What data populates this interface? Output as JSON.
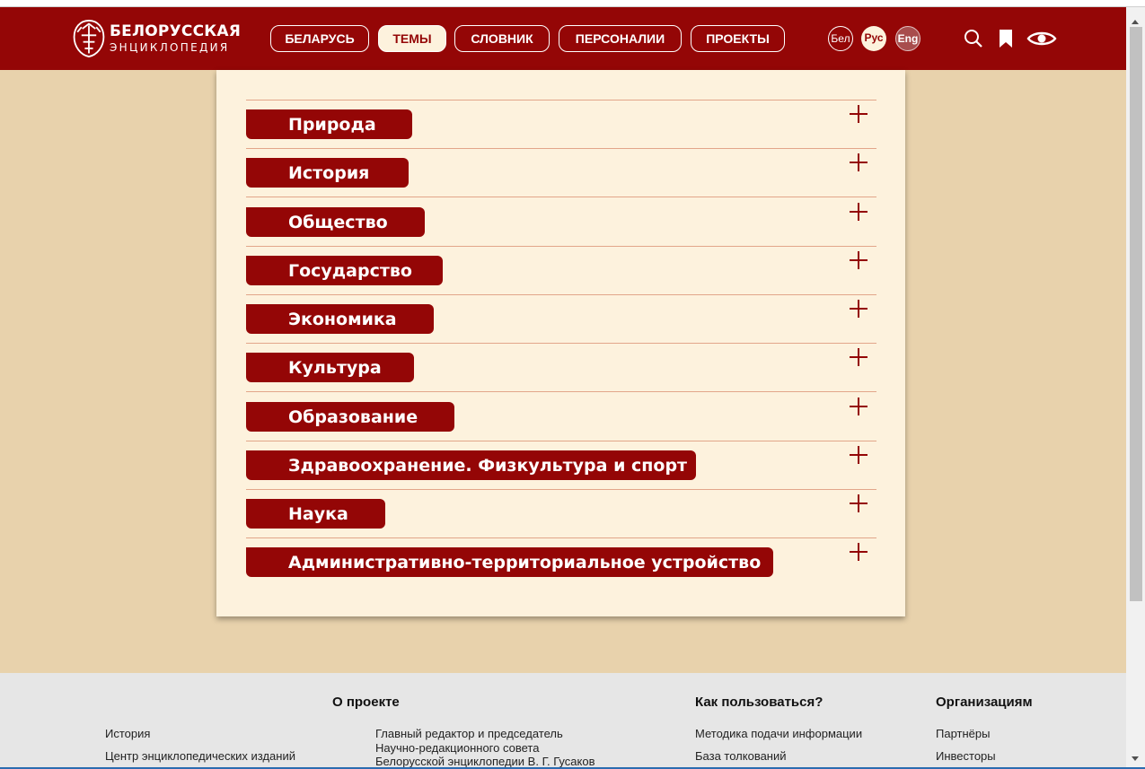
{
  "logo": {
    "line1": "БЕЛОРУССКАЯ",
    "line2": "ЭНЦИКЛОПЕДИЯ"
  },
  "nav": [
    {
      "label": "БЕЛАРУСЬ",
      "active": false
    },
    {
      "label": "ТЕМЫ",
      "active": true
    },
    {
      "label": "СЛОВНИК",
      "active": false
    },
    {
      "label": "ПЕРСОНАЛИИ",
      "active": false
    },
    {
      "label": "ПРОЕКТЫ",
      "active": false
    }
  ],
  "languages": [
    {
      "label": "Бел",
      "selected": false
    },
    {
      "label": "Рус",
      "selected": true
    },
    {
      "label": "Eng",
      "selected": false
    }
  ],
  "header_icons": [
    "search-icon",
    "bookmark-icon",
    "eye-icon"
  ],
  "topics": [
    "Природа",
    "История",
    "Общество",
    "Государство",
    "Экономика",
    "Культура",
    "Образование",
    "Здравоохранение. Физкультура и спорт",
    "Наука",
    "Административно-территориальное устройство"
  ],
  "footer": {
    "about": {
      "title": "О проекте",
      "col1": [
        "История",
        "Центр энциклопедических изданий"
      ],
      "col2": [
        "Главный редактор и председатель",
        "Научно-редакционного совета",
        "Белорусской энциклопедии В. Г. Гусаков"
      ]
    },
    "howto": {
      "title": "Как пользоваться?",
      "links": [
        "Методика подачи информации",
        "База толкований"
      ]
    },
    "orgs": {
      "title": "Организациям",
      "links": [
        "Партнёры",
        "Инвесторы"
      ]
    }
  },
  "colors": {
    "brand": "#940606",
    "panel": "#fdf2dd",
    "page_bg": "#e8d2ac",
    "footer_bg": "#e6e6e6",
    "divider": "#e2a68a"
  }
}
